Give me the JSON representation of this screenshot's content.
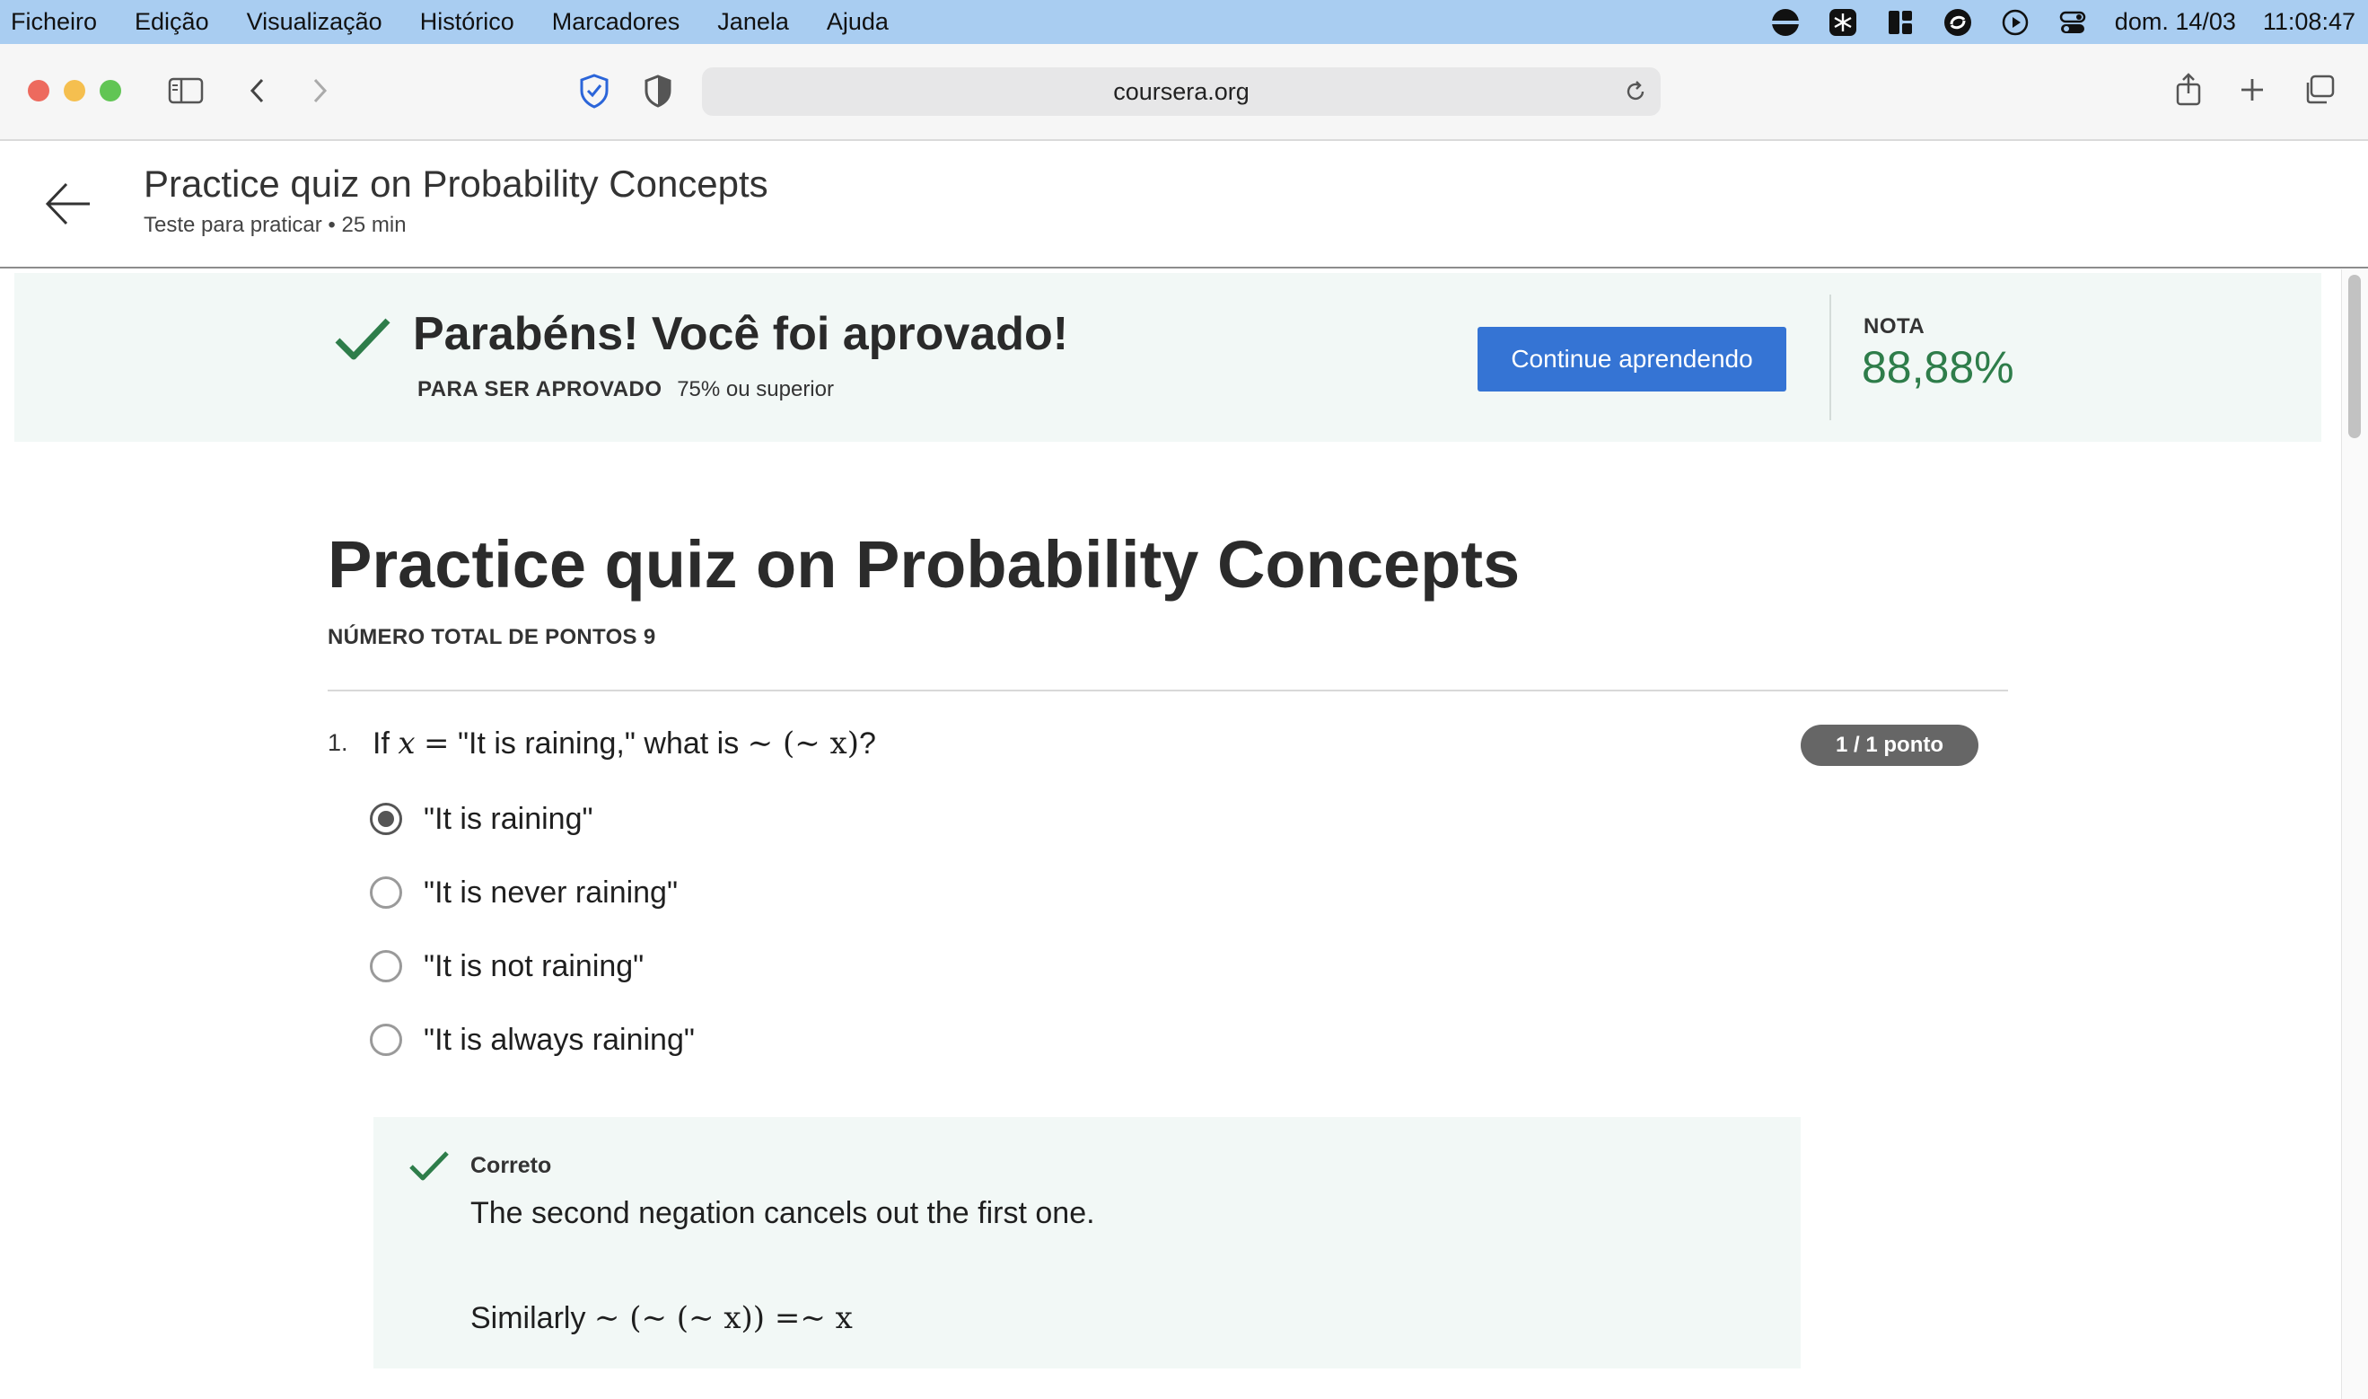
{
  "menubar": {
    "items": [
      "Ficheiro",
      "Edição",
      "Visualização",
      "Histórico",
      "Marcadores",
      "Janela",
      "Ajuda"
    ],
    "date": "dom. 14/03",
    "time": "11:08:47"
  },
  "browser": {
    "url": "coursera.org"
  },
  "header": {
    "title": "Practice quiz on Probability Concepts",
    "subtitle": "Teste para praticar • 25 min"
  },
  "banner": {
    "title": "Parabéns! Você foi aprovado!",
    "pass_label": "PARA SER APROVADO",
    "pass_value": "75% ou superior",
    "continue_label": "Continue aprendendo",
    "grade_label": "NOTA",
    "grade_value": "88,88%"
  },
  "quiz": {
    "title": "Practice quiz on Probability Concepts",
    "total_points": "NÚMERO TOTAL DE PONTOS 9",
    "questions": [
      {
        "number": "1.",
        "text_prefix": "If",
        "text_var": "x",
        "text_eq": "=",
        "text_mid": "\"It is raining,\" what is",
        "text_math": "∼ (∼ x)",
        "text_end": "?",
        "points": "1 / 1 ponto",
        "options": [
          {
            "label": "\"It is raining\"",
            "selected": true
          },
          {
            "label": "\"It is never raining\"",
            "selected": false
          },
          {
            "label": "\"It is not raining\"",
            "selected": false
          },
          {
            "label": "\"It is always raining\"",
            "selected": false
          }
        ],
        "feedback": {
          "label": "Correto",
          "text": "The second negation cancels out the first one.",
          "similar_prefix": "Similarly",
          "similar_math": "∼ (∼ (∼ x)) =∼ x"
        }
      }
    ]
  },
  "colors": {
    "menubar": "#a9cdf1",
    "banner_bg": "#f2f8f6",
    "success_green": "#2e7d4a",
    "primary_button": "#3574d4",
    "badge_gray": "#666666"
  }
}
